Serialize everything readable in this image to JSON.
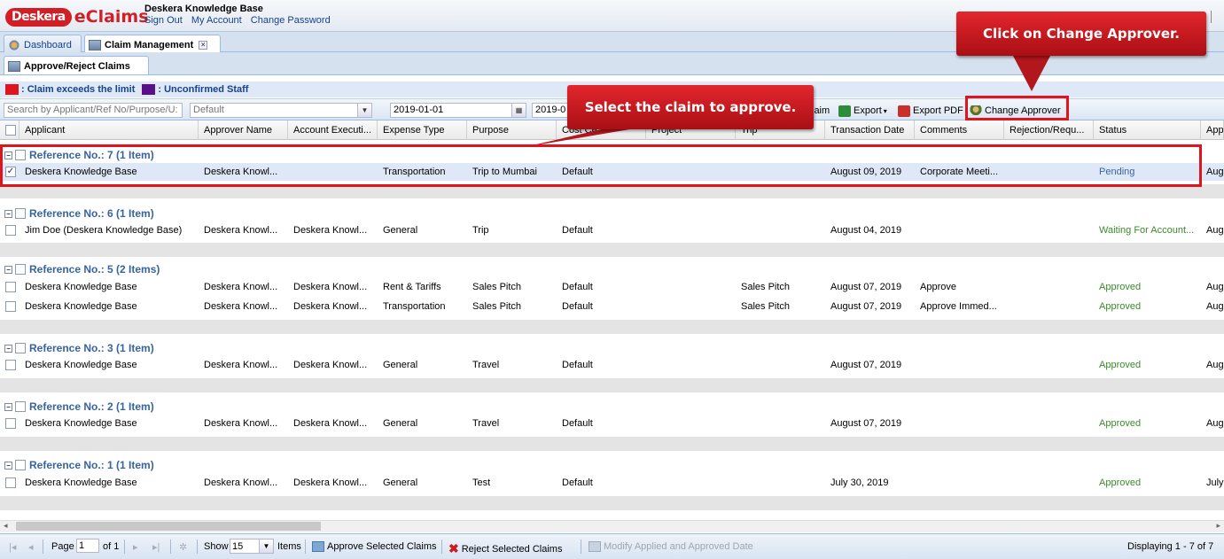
{
  "app": {
    "brand": "Deskera",
    "name": "eClaims",
    "org": "Deskera Knowledge Base"
  },
  "top_links": [
    "Sign Out",
    "My Account",
    "Change Password"
  ],
  "tabs": [
    {
      "label": "Dashboard"
    },
    {
      "label": "Claim Management"
    }
  ],
  "subtab": "Approve/Reject Claims",
  "legend": {
    "exceeds": ": Claim exceeds the limit",
    "unconfirmed": ": Unconfirmed Staff",
    "exceeds_color": "#e0141c",
    "unconfirmed_color": "#5a0f8c"
  },
  "toolbar": {
    "search_placeholder": "Search by Applicant/Ref No/Purpose/U:",
    "filter_value": "Default",
    "from_date": "2019-01-01",
    "to_date": "2019-0",
    "claim_partial": "laim",
    "export": "Export",
    "export_pdf": "Export PDF",
    "change_approver": "Change Approver"
  },
  "columns": [
    "Applicant",
    "Approver Name",
    "Account Executi...",
    "Expense Type",
    "Purpose",
    "Cost Ce...",
    "Project",
    "Trip",
    "Transaction Date",
    "Comments",
    "Rejection/Requ...",
    "Status",
    "App"
  ],
  "groups": [
    {
      "header": "Reference No.: 7 (1 Item)",
      "rows": [
        {
          "applicant": "Deskera Knowledge Base",
          "approver": "Deskera Knowl...",
          "account": "",
          "expense": "Transportation",
          "purpose": "Trip to Mumbai",
          "cost": "Default",
          "trip": "",
          "date": "August 09, 2019",
          "comments": "Corporate Meeti...",
          "status": "Pending",
          "app": "Aug",
          "checked": "✓"
        }
      ]
    },
    {
      "header": "Reference No.: 6 (1 Item)",
      "rows": [
        {
          "applicant": "Jim Doe (Deskera Knowledge Base)",
          "approver": "Deskera Knowl...",
          "account": "Deskera Knowl...",
          "expense": "General",
          "purpose": "Trip",
          "cost": "Default",
          "trip": "",
          "date": "August 04, 2019",
          "comments": "",
          "status": "Waiting For Account...",
          "app": "Aug",
          "checked": ""
        }
      ]
    },
    {
      "header": "Reference No.: 5 (2 Items)",
      "rows": [
        {
          "applicant": "Deskera Knowledge Base",
          "approver": "Deskera Knowl...",
          "account": "Deskera Knowl...",
          "expense": "Rent & Tariffs",
          "purpose": "Sales Pitch",
          "cost": "Default",
          "trip": "Sales Pitch",
          "date": "August 07, 2019",
          "comments": "Approve",
          "status": "Approved",
          "app": "Aug",
          "checked": ""
        },
        {
          "applicant": "Deskera Knowledge Base",
          "approver": "Deskera Knowl...",
          "account": "Deskera Knowl...",
          "expense": "Transportation",
          "purpose": "Sales Pitch",
          "cost": "Default",
          "trip": "Sales Pitch",
          "date": "August 07, 2019",
          "comments": "Approve Immed...",
          "status": "Approved",
          "app": "Aug",
          "checked": ""
        }
      ]
    },
    {
      "header": "Reference No.: 3 (1 Item)",
      "rows": [
        {
          "applicant": "Deskera Knowledge Base",
          "approver": "Deskera Knowl...",
          "account": "Deskera Knowl...",
          "expense": "General",
          "purpose": "Travel",
          "cost": "Default",
          "trip": "",
          "date": "August 07, 2019",
          "comments": "",
          "status": "Approved",
          "app": "Aug",
          "checked": ""
        }
      ]
    },
    {
      "header": "Reference No.: 2 (1 Item)",
      "rows": [
        {
          "applicant": "Deskera Knowledge Base",
          "approver": "Deskera Knowl...",
          "account": "Deskera Knowl...",
          "expense": "General",
          "purpose": "Travel",
          "cost": "Default",
          "trip": "",
          "date": "August 07, 2019",
          "comments": "",
          "status": "Approved",
          "app": "Aug",
          "checked": ""
        }
      ]
    },
    {
      "header": "Reference No.: 1 (1 Item)",
      "rows": [
        {
          "applicant": "Deskera Knowledge Base",
          "approver": "Deskera Knowl...",
          "account": "Deskera Knowl...",
          "expense": "General",
          "purpose": "Test",
          "cost": "Default",
          "trip": "",
          "date": "July 30, 2019",
          "comments": "",
          "status": "Approved",
          "app": "July",
          "checked": ""
        }
      ]
    }
  ],
  "pager": {
    "page_label": "Page",
    "page_value": "1",
    "of_label": "of 1",
    "show_label": "Show",
    "show_value": "15",
    "items_label": "Items",
    "approve": "Approve Selected Claims",
    "reject": "Reject Selected Claims",
    "modify": "Modify Applied and Approved Date",
    "displaying": "Displaying 1 - 7 of 7"
  },
  "callouts": {
    "select": "Select the claim to approve.",
    "change": "Click on Change Approver."
  },
  "colors": {
    "brand_red": "#d21f26",
    "status_green": "#3a8a2a",
    "group_blue": "#3764a0"
  }
}
